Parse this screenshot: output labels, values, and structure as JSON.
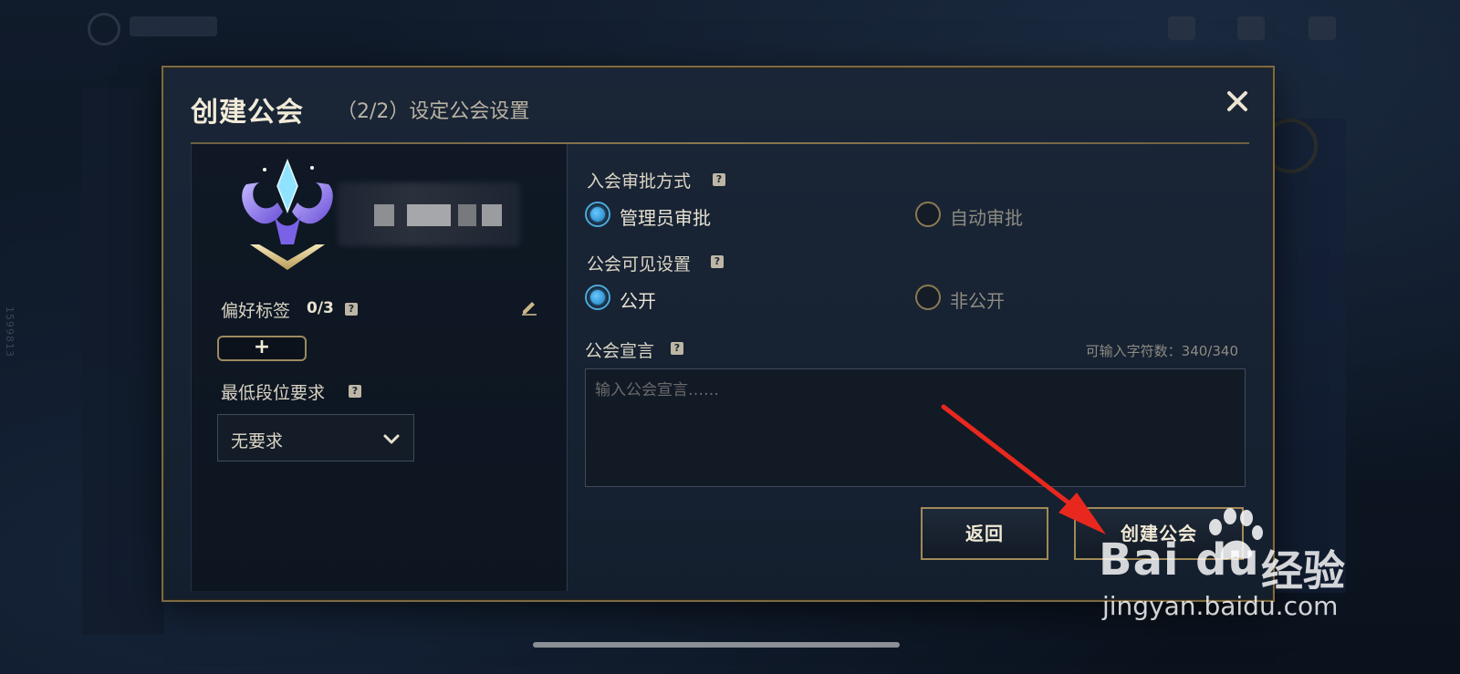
{
  "side_id": "1599813",
  "dialog": {
    "title": "创建公会",
    "subtitle": "（2/2）设定公会设置",
    "close_label": "✕"
  },
  "left": {
    "tags_label": "偏好标签",
    "tags_count": "0/3",
    "add_tag_label": "+",
    "rank_label": "最低段位要求",
    "rank_value": "无要求"
  },
  "approval": {
    "label": "入会审批方式",
    "options": [
      {
        "label": "管理员审批",
        "selected": true
      },
      {
        "label": "自动审批",
        "selected": false
      }
    ]
  },
  "visibility": {
    "label": "公会可见设置",
    "options": [
      {
        "label": "公开",
        "selected": true
      },
      {
        "label": "非公开",
        "selected": false
      }
    ]
  },
  "declaration": {
    "label": "公会宣言",
    "char_count": "可输入字符数：340/340",
    "placeholder": "输入公会宣言……",
    "value": ""
  },
  "buttons": {
    "back": "返回",
    "create": "创建公会"
  },
  "help_glyph": "?",
  "watermark": {
    "logo": "Bai du",
    "jingyan": "经验",
    "url": "jingyan.baidu.com"
  },
  "colors": {
    "accent_gold": "#a08a57",
    "radio_selected": "#3fa6e6",
    "annotation_arrow": "#e8281e"
  }
}
